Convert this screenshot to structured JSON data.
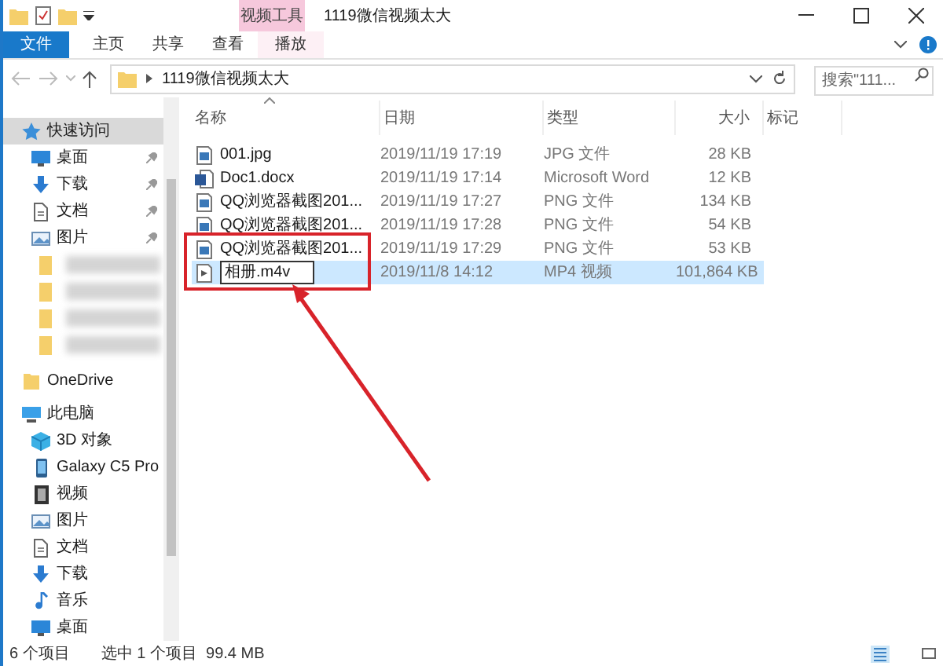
{
  "window": {
    "title": "1119微信视频太大",
    "context_group": "视频工具"
  },
  "ribbon_tabs": [
    {
      "label": "文件",
      "kind": "file",
      "selected": false
    },
    {
      "label": "主页",
      "kind": "tab",
      "selected": false
    },
    {
      "label": "共享",
      "kind": "tab",
      "selected": false
    },
    {
      "label": "查看",
      "kind": "tab",
      "selected": false
    },
    {
      "label": "播放",
      "kind": "context",
      "selected": false
    }
  ],
  "address": {
    "path": "1119微信视频太大",
    "search_placeholder": "搜索\"111..."
  },
  "sidebar": [
    {
      "kind": "star",
      "label": "快速访问",
      "selected": true,
      "pinned": false,
      "indent": false
    },
    {
      "kind": "desktop",
      "label": "桌面",
      "selected": false,
      "pinned": true,
      "indent": true
    },
    {
      "kind": "download",
      "label": "下载",
      "selected": false,
      "pinned": true,
      "indent": true
    },
    {
      "kind": "doc",
      "label": "文档",
      "selected": false,
      "pinned": true,
      "indent": true
    },
    {
      "kind": "pictures",
      "label": "图片",
      "selected": false,
      "pinned": true,
      "indent": true
    },
    {
      "kind": "blurred"
    },
    {
      "kind": "blurred"
    },
    {
      "kind": "blurred"
    },
    {
      "kind": "blurred"
    },
    {
      "kind": "folder",
      "label": "OneDrive",
      "selected": false,
      "pinned": false,
      "indent": false
    },
    {
      "kind": "pc",
      "label": "此电脑",
      "selected": false,
      "pinned": false,
      "indent": false
    },
    {
      "kind": "cube",
      "label": "3D 对象",
      "selected": false,
      "pinned": false,
      "indent": true
    },
    {
      "kind": "phone",
      "label": "Galaxy C5 Pro",
      "selected": false,
      "pinned": false,
      "indent": true
    },
    {
      "kind": "video",
      "label": "视频",
      "selected": false,
      "pinned": false,
      "indent": true
    },
    {
      "kind": "pictures",
      "label": "图片",
      "selected": false,
      "pinned": false,
      "indent": true
    },
    {
      "kind": "doc",
      "label": "文档",
      "selected": false,
      "pinned": false,
      "indent": true
    },
    {
      "kind": "download",
      "label": "下载",
      "selected": false,
      "pinned": false,
      "indent": true
    },
    {
      "kind": "music",
      "label": "音乐",
      "selected": false,
      "pinned": false,
      "indent": true
    },
    {
      "kind": "desktop",
      "label": "桌面",
      "selected": false,
      "pinned": false,
      "indent": true
    }
  ],
  "table": {
    "columns": [
      "名称",
      "日期",
      "类型",
      "大小",
      "标记"
    ],
    "rows": [
      {
        "kind": "image",
        "name": "001.jpg",
        "date": "2019/11/19 17:19",
        "type": "JPG 文件",
        "size": "28 KB",
        "selected": false,
        "renaming": false
      },
      {
        "kind": "word",
        "name": "Doc1.docx",
        "date": "2019/11/19 17:14",
        "type": "Microsoft Word",
        "size": "12 KB",
        "selected": false,
        "renaming": false
      },
      {
        "kind": "image",
        "name": "QQ浏览器截图201...",
        "date": "2019/11/19 17:27",
        "type": "PNG 文件",
        "size": "134 KB",
        "selected": false,
        "renaming": false
      },
      {
        "kind": "image",
        "name": "QQ浏览器截图201...",
        "date": "2019/11/19 17:28",
        "type": "PNG 文件",
        "size": "54 KB",
        "selected": false,
        "renaming": false
      },
      {
        "kind": "image",
        "name": "QQ浏览器截图201...",
        "date": "2019/11/19 17:29",
        "type": "PNG 文件",
        "size": "53 KB",
        "selected": false,
        "renaming": false
      },
      {
        "kind": "video",
        "name": "相册.m4v",
        "date": "2019/11/8 14:12",
        "type": "MP4 视频",
        "size": "101,864 KB",
        "selected": true,
        "renaming": true
      }
    ]
  },
  "status_bar": {
    "count": "6 个项目",
    "selection": "选中 1 个项目  99.4 MB"
  }
}
